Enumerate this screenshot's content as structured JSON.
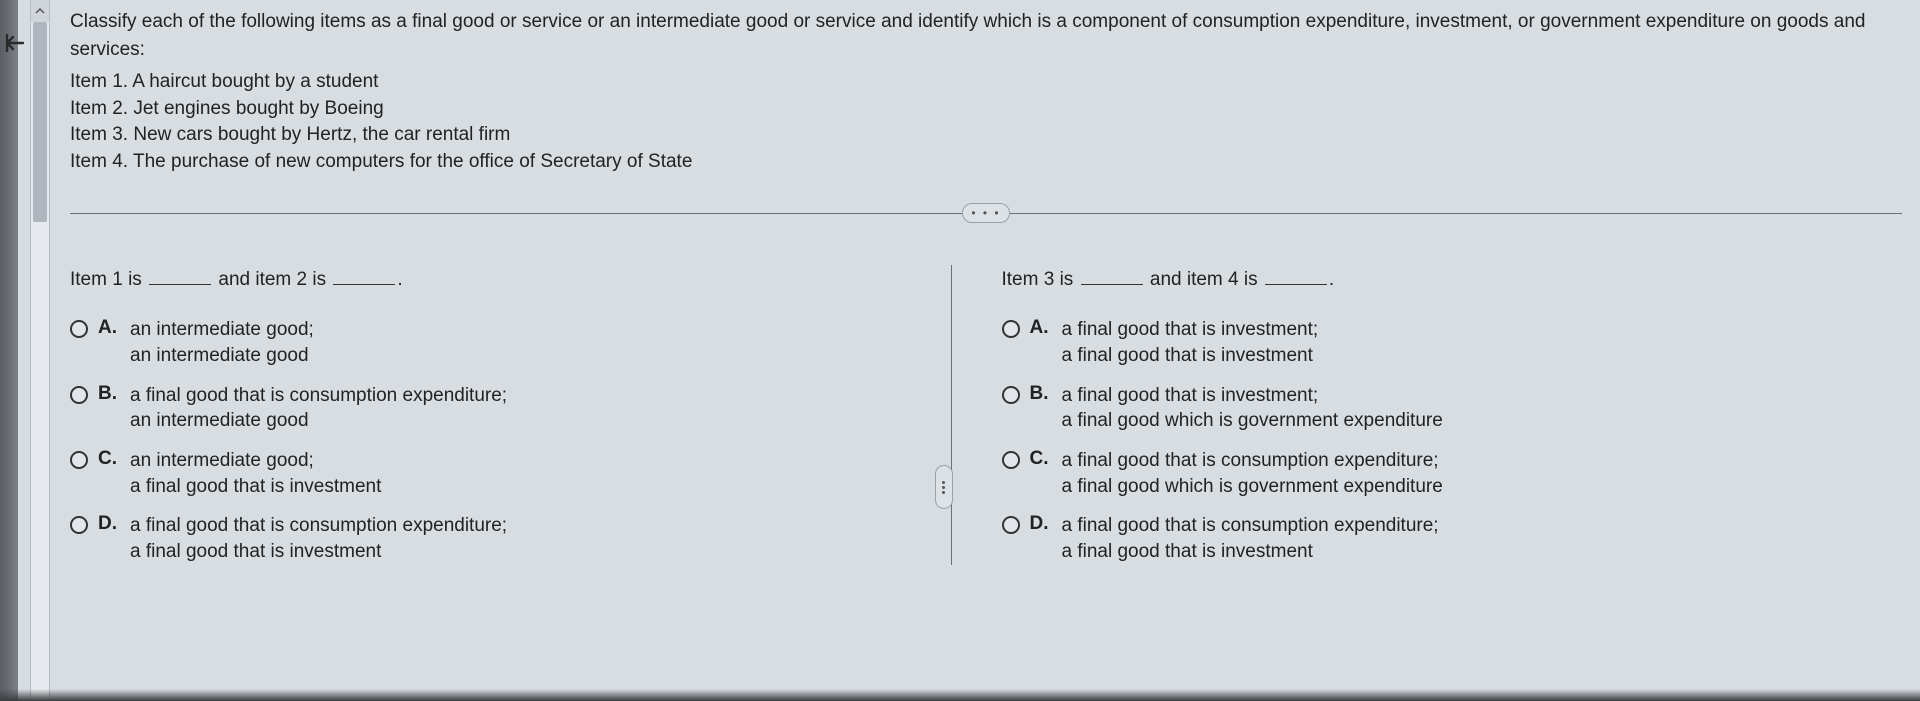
{
  "prompt": "Classify each of the following items as a final good or service or an intermediate good or service and identify which is a component of consumption expenditure, investment, or government expenditure on goods and services:",
  "items": {
    "i1": "Item 1. A haircut bought by a student",
    "i2": "Item 2. Jet engines bought by Boeing",
    "i3": "Item 3. New cars bought by Hertz, the car rental firm",
    "i4": "Item 4. The purchase of  new computers for the office of Secretary of State"
  },
  "divider_label": "• • •",
  "q1": {
    "stem_a": "Item 1 is",
    "stem_b": "and item 2 is",
    "stem_c": ".",
    "options": {
      "A": {
        "letter": "A.",
        "text": "an intermediate good;\nan intermediate good"
      },
      "B": {
        "letter": "B.",
        "text": "a final good that is consumption expenditure;\nan intermediate good"
      },
      "C": {
        "letter": "C.",
        "text": "an intermediate good;\na final good that is investment"
      },
      "D": {
        "letter": "D.",
        "text": "a final good that is consumption expenditure;\na final good that is investment"
      }
    }
  },
  "q2": {
    "stem_a": "Item 3 is",
    "stem_b": "and item 4 is",
    "stem_c": ".",
    "options": {
      "A": {
        "letter": "A.",
        "text": "a final good that is investment;\na final good that is investment"
      },
      "B": {
        "letter": "B.",
        "text": "a final good that is investment;\na final good which is government expenditure"
      },
      "C": {
        "letter": "C.",
        "text": "a final good that is consumption expenditure;\na final good which is government expenditure"
      },
      "D": {
        "letter": "D.",
        "text": "a final good that is consumption expenditure;\na final good that is investment"
      }
    }
  }
}
